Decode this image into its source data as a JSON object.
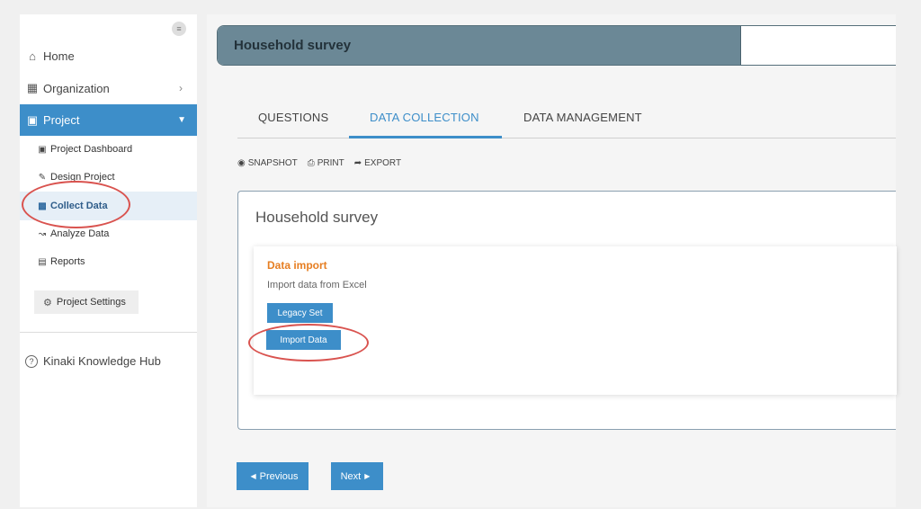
{
  "sidebar": {
    "menu_icon": "≡",
    "home": {
      "label": "Home",
      "icon": "home-icon"
    },
    "organization": {
      "label": "Organization",
      "icon": "columns-icon"
    },
    "project": {
      "label": "Project",
      "icon": "grid-icon"
    },
    "sub_items": {
      "dashboard": "Project Dashboard",
      "design": "Design Project",
      "collect": "Collect Data",
      "analyze": "Analyze Data",
      "reports": "Reports"
    },
    "settings": "Project Settings",
    "hub": "Kinaki Knowledge Hub"
  },
  "header": {
    "title": "Household survey"
  },
  "tabs": {
    "questions": "QUESTIONS",
    "collection": "DATA COLLECTION",
    "management": "DATA MANAGEMENT",
    "active": "DATA COLLECTION"
  },
  "toolbar": {
    "snapshot": "SNAPSHOT",
    "print": "PRINT",
    "export": "EXPORT"
  },
  "card": {
    "title": "Household survey",
    "section_title": "Data import",
    "section_desc": "Import data from Excel",
    "legacy_button": "Legacy Set",
    "import_button": "Import Data"
  },
  "pager": {
    "previous": "Previous",
    "next": "Next"
  },
  "colors": {
    "accent": "#3d8ec9",
    "header_fill": "#6b8896",
    "section_title": "#e67e22",
    "annotation": "#d9534f"
  }
}
